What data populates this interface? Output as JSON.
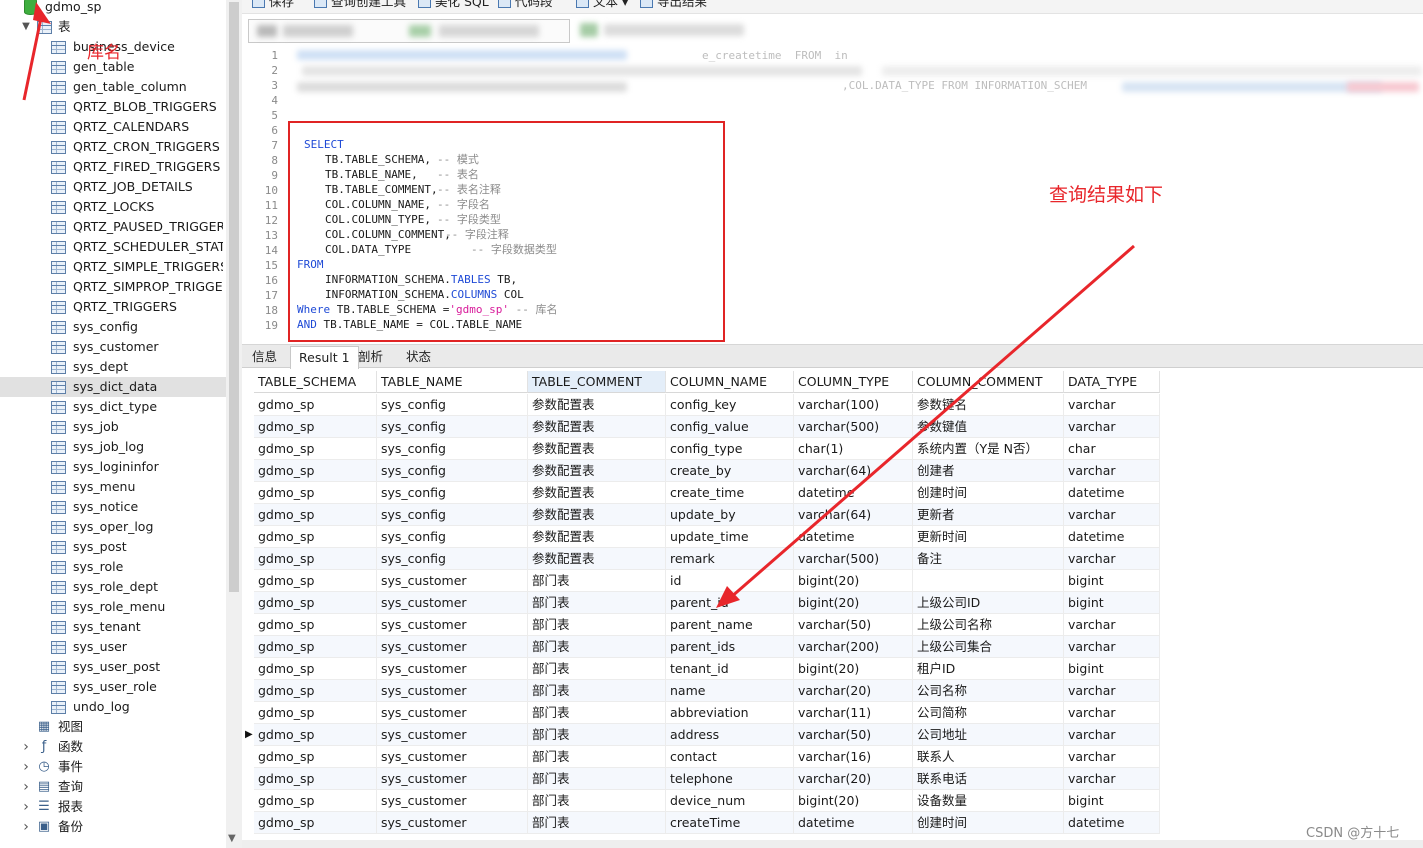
{
  "tree": {
    "database": "gdmo_sp",
    "tables_folder": "表",
    "tables": [
      "business_device",
      "gen_table",
      "gen_table_column",
      "QRTZ_BLOB_TRIGGERS",
      "QRTZ_CALENDARS",
      "QRTZ_CRON_TRIGGERS",
      "QRTZ_FIRED_TRIGGERS",
      "QRTZ_JOB_DETAILS",
      "QRTZ_LOCKS",
      "QRTZ_PAUSED_TRIGGER_G",
      "QRTZ_SCHEDULER_STATE",
      "QRTZ_SIMPLE_TRIGGERS",
      "QRTZ_SIMPROP_TRIGGERS",
      "QRTZ_TRIGGERS",
      "sys_config",
      "sys_customer",
      "sys_dept",
      "sys_dict_data",
      "sys_dict_type",
      "sys_job",
      "sys_job_log",
      "sys_logininfor",
      "sys_menu",
      "sys_notice",
      "sys_oper_log",
      "sys_post",
      "sys_role",
      "sys_role_dept",
      "sys_role_menu",
      "sys_tenant",
      "sys_user",
      "sys_user_post",
      "sys_user_role",
      "undo_log"
    ],
    "selected_table": "sys_dict_data",
    "categories": [
      {
        "label": "视图",
        "icon": "view-icon"
      },
      {
        "label": "函数",
        "icon": "function-icon"
      },
      {
        "label": "事件",
        "icon": "event-icon"
      },
      {
        "label": "查询",
        "icon": "query-icon"
      },
      {
        "label": "报表",
        "icon": "report-icon"
      },
      {
        "label": "备份",
        "icon": "backup-icon"
      }
    ]
  },
  "toolbar": {
    "save": "保存",
    "query_builder": "查询创建工具",
    "beautify": "美化 SQL",
    "snippet": "代码段",
    "text": "文本",
    "export": "导出结果"
  },
  "editor": {
    "line_numbers": [
      "1",
      "2",
      "3",
      "4",
      "5",
      "6",
      "7",
      "8",
      "9",
      "10",
      "11",
      "12",
      "13",
      "14",
      "15",
      "16",
      "17",
      "18",
      "19"
    ],
    "line1_visible": "e_createtime  FROM  in",
    "line3_visible": ",COL.DATA_TYPE FROM INFORMATION_SCHEM",
    "sql": {
      "l7": "SELECT",
      "l8_code": "TB.TABLE_SCHEMA,",
      "l8_comment": "-- 模式",
      "l9_code": "TB.TABLE_NAME,",
      "l9_comment": "-- 表名",
      "l10_code": "TB.TABLE_COMMENT,",
      "l10_comment": "-- 表名注释",
      "l11_code": "COL.COLUMN_NAME,",
      "l11_comment": "-- 字段名",
      "l12_code": "COL.COLUMN_TYPE,",
      "l12_comment": "-- 字段类型",
      "l13_code": "COL.COLUMN_COMMENT,",
      "l13_comment": "-- 字段注释",
      "l14_code": "COL.DATA_TYPE",
      "l14_comment": "-- 字段数据类型",
      "l15": "FROM",
      "l16_a": "INFORMATION_SCHEMA.",
      "l16_b": "TABLES",
      "l16_c": " TB,",
      "l17_a": "INFORMATION_SCHEMA.",
      "l17_b": "COLUMNS",
      "l17_c": " COL",
      "l18_kw": "Where",
      "l18_code": " TB.TABLE_SCHEMA =",
      "l18_str": "'gdmo_sp'",
      "l18_comment": " -- 库名",
      "l19_kw": "AND",
      "l19_code": " TB.TABLE_NAME = COL.TABLE_NAME"
    }
  },
  "tabs": [
    "信息",
    "Result 1",
    "剖析",
    "状态"
  ],
  "grid": {
    "columns": [
      "TABLE_SCHEMA",
      "TABLE_NAME",
      "TABLE_COMMENT",
      "COLUMN_NAME",
      "COLUMN_TYPE",
      "COLUMN_COMMENT",
      "DATA_TYPE"
    ],
    "rows": [
      [
        "gdmo_sp",
        "sys_config",
        "参数配置表",
        "config_key",
        "varchar(100)",
        "参数键名",
        "varchar"
      ],
      [
        "gdmo_sp",
        "sys_config",
        "参数配置表",
        "config_value",
        "varchar(500)",
        "参数键值",
        "varchar"
      ],
      [
        "gdmo_sp",
        "sys_config",
        "参数配置表",
        "config_type",
        "char(1)",
        "系统内置（Y是 N否）",
        "char"
      ],
      [
        "gdmo_sp",
        "sys_config",
        "参数配置表",
        "create_by",
        "varchar(64)",
        "创建者",
        "varchar"
      ],
      [
        "gdmo_sp",
        "sys_config",
        "参数配置表",
        "create_time",
        "datetime",
        "创建时间",
        "datetime"
      ],
      [
        "gdmo_sp",
        "sys_config",
        "参数配置表",
        "update_by",
        "varchar(64)",
        "更新者",
        "varchar"
      ],
      [
        "gdmo_sp",
        "sys_config",
        "参数配置表",
        "update_time",
        "datetime",
        "更新时间",
        "datetime"
      ],
      [
        "gdmo_sp",
        "sys_config",
        "参数配置表",
        "remark",
        "varchar(500)",
        "备注",
        "varchar"
      ],
      [
        "gdmo_sp",
        "sys_customer",
        "部门表",
        "id",
        "bigint(20)",
        "",
        "bigint"
      ],
      [
        "gdmo_sp",
        "sys_customer",
        "部门表",
        "parent_id",
        "bigint(20)",
        "上级公司ID",
        "bigint"
      ],
      [
        "gdmo_sp",
        "sys_customer",
        "部门表",
        "parent_name",
        "varchar(50)",
        "上级公司名称",
        "varchar"
      ],
      [
        "gdmo_sp",
        "sys_customer",
        "部门表",
        "parent_ids",
        "varchar(200)",
        "上级公司集合",
        "varchar"
      ],
      [
        "gdmo_sp",
        "sys_customer",
        "部门表",
        "tenant_id",
        "bigint(20)",
        "租户ID",
        "bigint"
      ],
      [
        "gdmo_sp",
        "sys_customer",
        "部门表",
        "name",
        "varchar(20)",
        "公司名称",
        "varchar"
      ],
      [
        "gdmo_sp",
        "sys_customer",
        "部门表",
        "abbreviation",
        "varchar(11)",
        "公司简称",
        "varchar"
      ],
      [
        "gdmo_sp",
        "sys_customer",
        "部门表",
        "address",
        "varchar(50)",
        "公司地址",
        "varchar"
      ],
      [
        "gdmo_sp",
        "sys_customer",
        "部门表",
        "contact",
        "varchar(16)",
        "联系人",
        "varchar"
      ],
      [
        "gdmo_sp",
        "sys_customer",
        "部门表",
        "telephone",
        "varchar(20)",
        "联系电话",
        "varchar"
      ],
      [
        "gdmo_sp",
        "sys_customer",
        "部门表",
        "device_num",
        "bigint(20)",
        "设备数量",
        "bigint"
      ],
      [
        "gdmo_sp",
        "sys_customer",
        "部门表",
        "createTime",
        "datetime",
        "创建时间",
        "datetime"
      ]
    ],
    "current_row_index": 15
  },
  "annotations": {
    "library_name": "库名",
    "result_note": "查询结果如下",
    "color": "#e8262b"
  },
  "watermark": "CSDN @方十七"
}
